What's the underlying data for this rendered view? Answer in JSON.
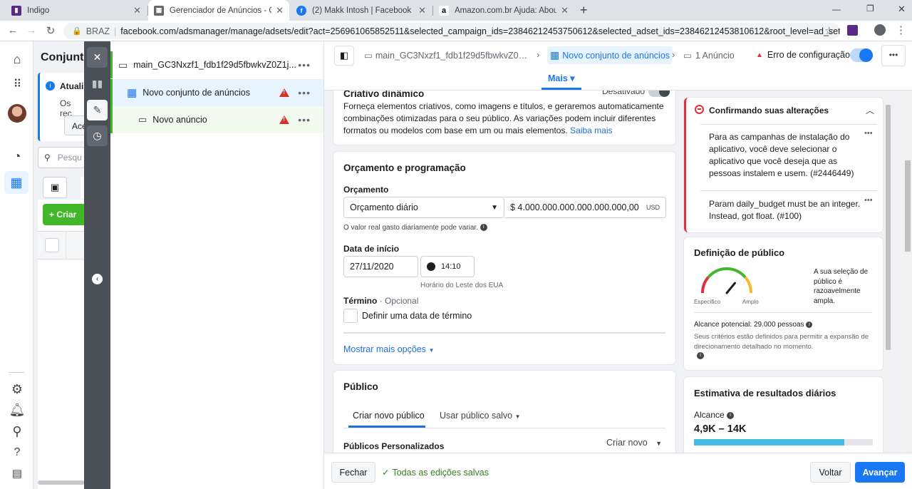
{
  "browser": {
    "tabs": [
      {
        "title": "Indigo",
        "favicon": "indigo-logo"
      },
      {
        "title": "Gerenciador de Anúncios - Gerenc",
        "favicon": "ads-manager"
      },
      {
        "title": "(2) Makk Intosh | Facebook",
        "favicon": "facebook"
      },
      {
        "title": "Amazon.com.br Ajuda: About Co",
        "favicon": "amazon"
      }
    ],
    "new_tab": "+",
    "window_controls": [
      "—",
      "❐",
      "✕"
    ],
    "host_label": "BRAZ",
    "url": "facebook.com/adsmanager/manage/adsets/edit?act=256961065852511&selected_campaign_ids=23846212453750612&selected_adset_ids=23846212453810612&root_level=ad_set"
  },
  "left_panel": {
    "title": "Conjunto",
    "notice_title": "Atuali",
    "notice_text": "Os rec",
    "notice_button": "Ace",
    "search_placeholder": "Pesqu",
    "create_button": "+ Criar"
  },
  "tree": {
    "campaign": "main_GC3Nxzf1_fdb1f29d5fbwkvZ0Z1j...",
    "adset": "Novo conjunto de anúncios",
    "ad": "Novo anúncio",
    "more": "•••"
  },
  "header": {
    "crumb_campaign": "main_GC3Nxzf1_fdb1f29d5fbwkvZ0Z1j...",
    "crumb_adset": "Novo conjunto de anúncios",
    "crumb_ad": "1 Anúncio",
    "error": "Erro de configuração",
    "more_tab": "Mais",
    "more_btn": "•••"
  },
  "creative": {
    "title": "Criativo dinâmico",
    "toggle_label": "Desativado",
    "description": "Forneça elementos criativos, como imagens e títulos, e geraremos automaticamente combinações otimizadas para o seu público. As variações podem incluir diferentes formatos ou modelos com base em um ou mais elementos.",
    "learn_more": "Saiba mais"
  },
  "budget": {
    "title": "Orçamento e programação",
    "budget_label": "Orçamento",
    "budget_type": "Orçamento diário",
    "budget_value": "$ 4.000.000.000.000.000.000,00",
    "currency": "USD",
    "budget_note": "O valor real gasto diariamente pode variar.",
    "start_label": "Data de início",
    "start_date": "27/11/2020",
    "start_time": "14:10",
    "timezone": "Horário do Leste dos EUA",
    "end_label": "Término",
    "end_optional": "· Opcional",
    "end_checkbox": "Definir uma data de término",
    "more_options": "Mostrar mais opções"
  },
  "audience": {
    "title": "Público",
    "tab_new": "Criar novo público",
    "tab_saved": "Usar público salvo",
    "custom_label": "Públicos Personalizados",
    "create_new": "Criar novo"
  },
  "alerts": {
    "title": "Confirmando suas alterações",
    "items": [
      "Para as campanhas de instalação do aplicativo, você deve selecionar o aplicativo que você deseja que as pessoas instalem e usem. (#2446449)",
      "Param daily_budget must be an integer. Instead, got float. (#100)"
    ]
  },
  "audience_def": {
    "title": "Definição de público",
    "gauge_level": 0.72,
    "left_label": "Específico",
    "right_label": "Amplo",
    "summary": "A sua seleção de público é razoavelmente ampla.",
    "reach": "Alcance potencial: 29.000 pessoas",
    "note": "Seus critérios estão definidos para permitir a expansão de direcionamento detalhado no momento."
  },
  "estimate": {
    "title": "Estimativa de resultados diários",
    "reach_label": "Alcance",
    "reach_value": "4,9K – 14K",
    "bar_fill": 0.84
  },
  "footer": {
    "close": "Fechar",
    "saved": "Todas as edições salvas",
    "back": "Voltar",
    "next": "Avançar"
  },
  "colors": {
    "accent": "#1877f2",
    "error": "#e02f3e",
    "success": "#42b72a",
    "link": "#216fdb"
  }
}
